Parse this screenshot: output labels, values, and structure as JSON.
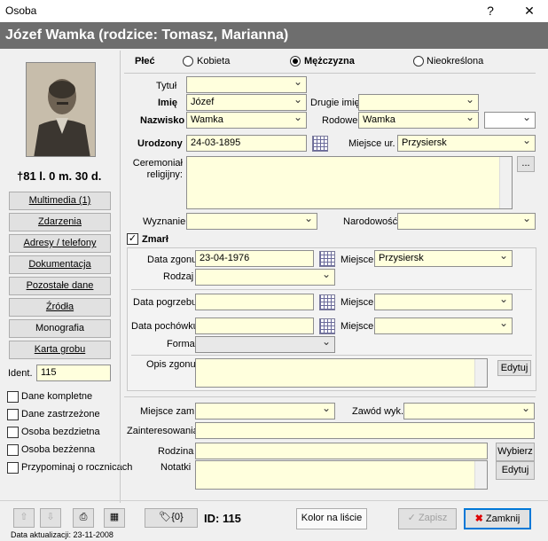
{
  "window": {
    "title": "Osoba",
    "help": "?",
    "close": "✕"
  },
  "header": {
    "title": "Józef Wamka (rodzice: Tomasz, Marianna)"
  },
  "left": {
    "lifespan": "†81 l. 0 m. 30 d.",
    "buttons": [
      "Multimedia (1)",
      "Zdarzenia",
      "Adresy / telefony",
      "Dokumentacja",
      "Pozostałe dane",
      "Źródła",
      "Monografia",
      "Karta grobu"
    ],
    "ident_label": "Ident.",
    "ident_value": "115",
    "checks": [
      "Dane kompletne",
      "Dane zastrzeżone",
      "Osoba bezdzietna",
      "Osoba bezżenna",
      "Przypominaj o rocznicach"
    ]
  },
  "sex": {
    "label": "Płeć",
    "options": [
      "Kobieta",
      "Mężczyzna",
      "Nieokreślona"
    ],
    "selected": "Mężczyzna"
  },
  "form": {
    "tytul_label": "Tytuł",
    "tytul": "",
    "imie_label": "Imię",
    "imie": "Józef",
    "drugie_label": "Drugie imię",
    "drugie": "",
    "nazwisko_label": "Nazwisko",
    "nazwisko": "Wamka",
    "rodowe_label": "Rodowe",
    "rodowe": "Wamka",
    "urodzony_label": "Urodzony",
    "urodzony": "24-03-1895",
    "miejsce_ur_label": "Miejsce ur.",
    "miejsce_ur": "Przysiersk",
    "ceremonial_label": "Ceremoniał religijny:",
    "ellipsis": "...",
    "wyznanie_label": "Wyznanie",
    "wyznanie": "",
    "narodowosc_label": "Narodowość",
    "narodowosc": ""
  },
  "death": {
    "zmarl_label": "Zmarł",
    "data_zgonu_label": "Data zgonu",
    "data_zgonu": "23-04-1976",
    "miejsce_label": "Miejsce",
    "miejsce_zgonu": "Przysiersk",
    "rodzaj_label": "Rodzaj",
    "pogrzebu_label": "Data pogrzebu",
    "pochowku_label": "Data pochówku",
    "forma_label": "Forma",
    "opis_label": "Opis zgonu",
    "edytuj": "Edytuj"
  },
  "other": {
    "miejsce_zam_label": "Miejsce zam.",
    "zawod_label": "Zawód wyk.",
    "zainteresowania_label": "Zainteresowania",
    "rodzina_label": "Rodzina",
    "wybierz": "Wybierz",
    "notatki_label": "Notatki",
    "edytuj": "Edytuj"
  },
  "footer": {
    "count": "{0}",
    "id_text": "ID: 115",
    "kolor": "Kolor na liście",
    "zapisz": "Zapisz",
    "zamknij": "Zamknij",
    "update": "Data aktualizacji: 23-11-2008"
  }
}
